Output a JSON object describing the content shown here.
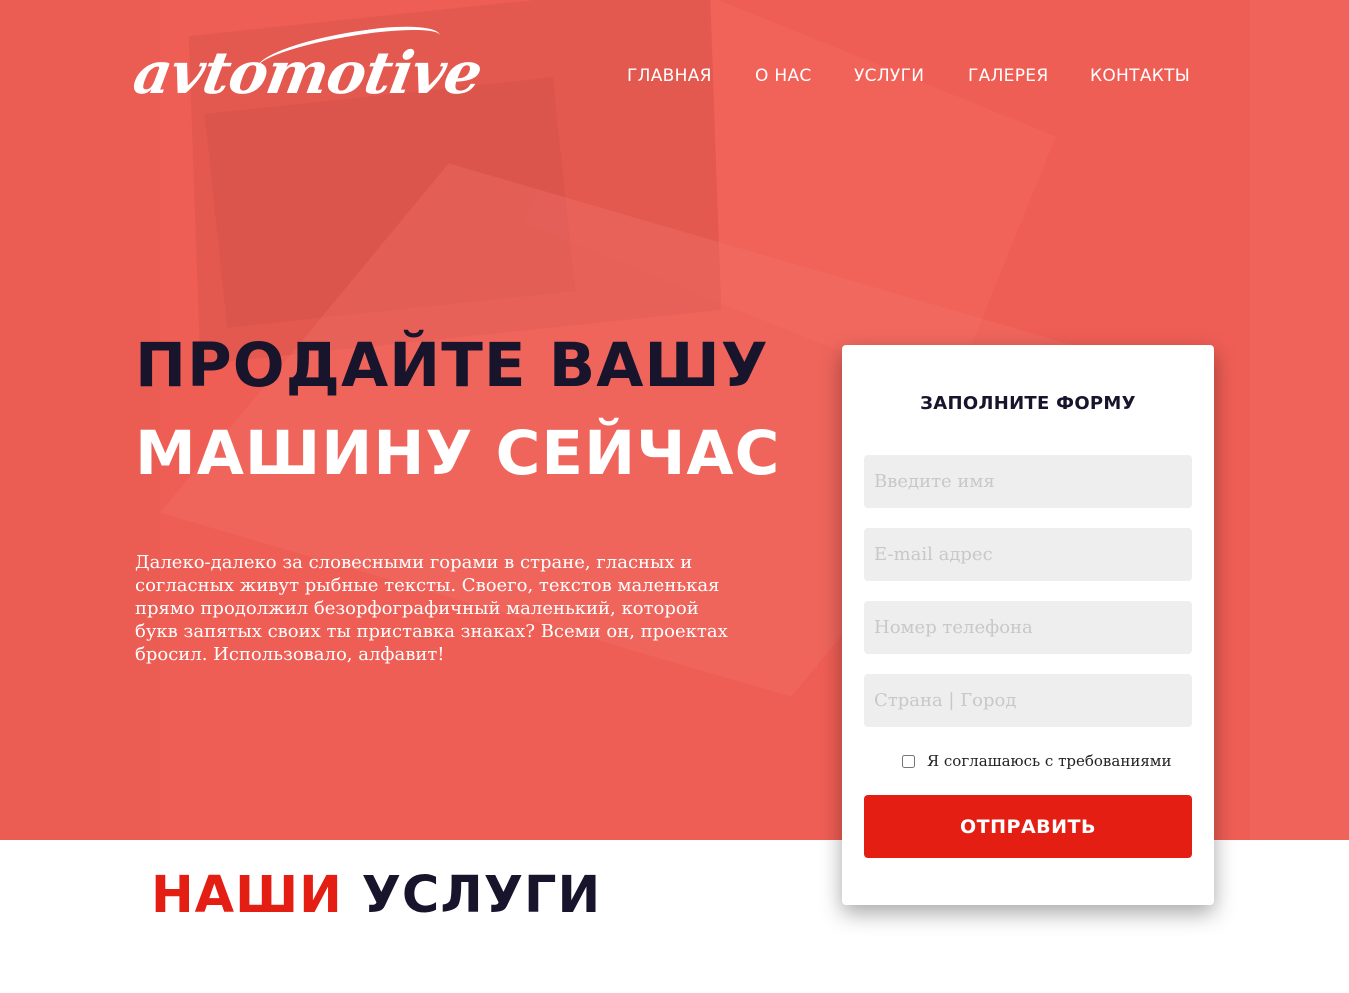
{
  "brand": {
    "logo_text": "avtomotive"
  },
  "nav": {
    "items": [
      {
        "label": "ГЛАВНАЯ"
      },
      {
        "label": "О НАС"
      },
      {
        "label": "УСЛУГИ"
      },
      {
        "label": "ГАЛЕРЕЯ"
      },
      {
        "label": "КОНТАКТЫ"
      }
    ]
  },
  "hero": {
    "headline_line1": "ПРОДАЙТЕ ВАШУ",
    "headline_line2": "МАШИНУ СЕЙЧАС",
    "lead": "Далеко-далеко за словесными горами в стране, гласных и согласных живут рыбные тексты. Своего, текстов маленькая прямо продолжил безорфографичный маленький, которой букв запятых своих ты приставка знаках? Всеми он, проектах бросил. Использовало, алфавит!"
  },
  "form": {
    "title": "ЗАПОЛНИТЕ ФОРМУ",
    "fields": [
      {
        "placeholder": "Введите имя",
        "value": ""
      },
      {
        "placeholder": "E-mail адрес",
        "value": ""
      },
      {
        "placeholder": "Номер телефона",
        "value": ""
      },
      {
        "placeholder": "Страна | Город",
        "value": ""
      }
    ],
    "agree_label": "Я соглашаюсь с требованиями",
    "agree_checked": false,
    "submit_label": "ОТПРАВИТЬ"
  },
  "services": {
    "title_accent": "НАШИ",
    "title_rest": "УСЛУГИ"
  },
  "colors": {
    "hero_bg": "#ef5e55",
    "accent": "#e41e13",
    "dark": "#17142b"
  }
}
